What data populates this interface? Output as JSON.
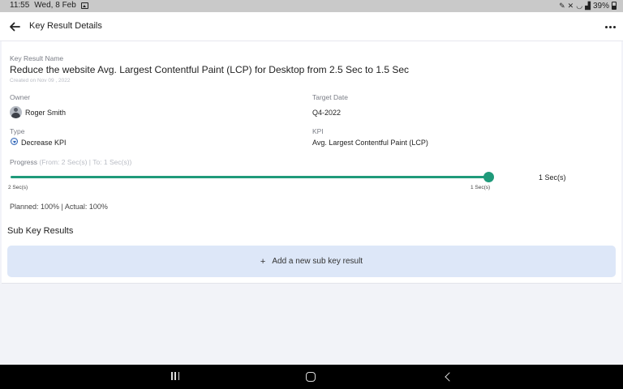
{
  "status_bar": {
    "time": "11:55",
    "date": "Wed, 8 Feb",
    "battery": "39%",
    "icons": [
      "gallery-icon",
      "pen-icon",
      "mute-icon",
      "wifi-icon",
      "signal-icon",
      "battery-icon"
    ]
  },
  "app_bar": {
    "title": "Key Result Details",
    "back_icon": "arrow-left-icon",
    "menu_icon": "more-horizontal-icon"
  },
  "key_result": {
    "name_label": "Key Result Name",
    "name": "Reduce the website Avg. Largest Contentful Paint (LCP) for Desktop from 2.5 Sec to 1.5 Sec",
    "created": "Created on Nov 09 , 2022",
    "owner_label": "Owner",
    "owner": "Roger Smith",
    "target_date_label": "Target Date",
    "target_date": "Q4-2022",
    "type_label": "Type",
    "type": "Decrease KPI",
    "kpi_label": "KPI",
    "kpi": "Avg. Largest Contentful Paint (LCP)",
    "progress_label": "Progress",
    "progress_range": "(From: 2 Sec(s) | To: 1 Sec(s))",
    "progress_start": "2 Sec(s)",
    "progress_end": "1 Sec(s)",
    "progress_current": "1 Sec(s)",
    "progress_fraction": 1.0,
    "planned_actual": "Planned:  100% | Actual: 100%"
  },
  "sub_key_results": {
    "heading": "Sub Key Results",
    "add_label": "Add a new sub key result"
  },
  "colors": {
    "accent": "#1f9a7a",
    "add_button_bg": "#dde7f8",
    "background": "#f2f3f8"
  }
}
